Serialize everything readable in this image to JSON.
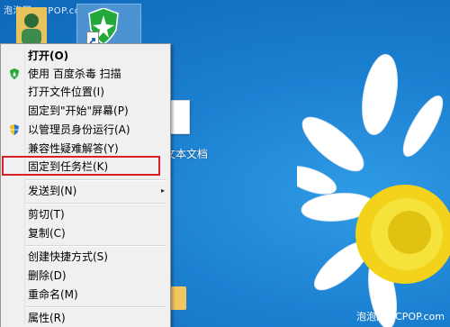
{
  "watermark": {
    "top": "泡泡网 PCPOP.com",
    "bottom": "泡泡网 PCPOP.com"
  },
  "desktop": {
    "file_label": "文本文档"
  },
  "context_menu": {
    "items": [
      {
        "label": "打开(O)"
      },
      {
        "label": "使用 百度杀毒 扫描"
      },
      {
        "label": "打开文件位置(I)"
      },
      {
        "label": "固定到\"开始\"屏幕(P)"
      },
      {
        "label": "以管理员身份运行(A)"
      },
      {
        "label": "兼容性疑难解答(Y)"
      },
      {
        "label": "固定到任务栏(K)"
      },
      {
        "label": "发送到(N)"
      },
      {
        "label": "剪切(T)"
      },
      {
        "label": "复制(C)"
      },
      {
        "label": "创建快捷方式(S)"
      },
      {
        "label": "删除(D)"
      },
      {
        "label": "重命名(M)"
      },
      {
        "label": "属性(R)"
      }
    ],
    "submenu_arrow": "▸"
  },
  "colors": {
    "highlight_border": "#d9202a",
    "menu_bg": "#f0f0f0",
    "desktop_blue": "#1b7fd0"
  },
  "icons": {
    "user": "user-folder-icon",
    "shortcut": "baidu-antivirus-shield-icon",
    "menu_scan": "baidu-antivirus-icon",
    "menu_admin": "uac-shield-icon",
    "document": "text-document-icon",
    "folder": "folder-icon"
  }
}
